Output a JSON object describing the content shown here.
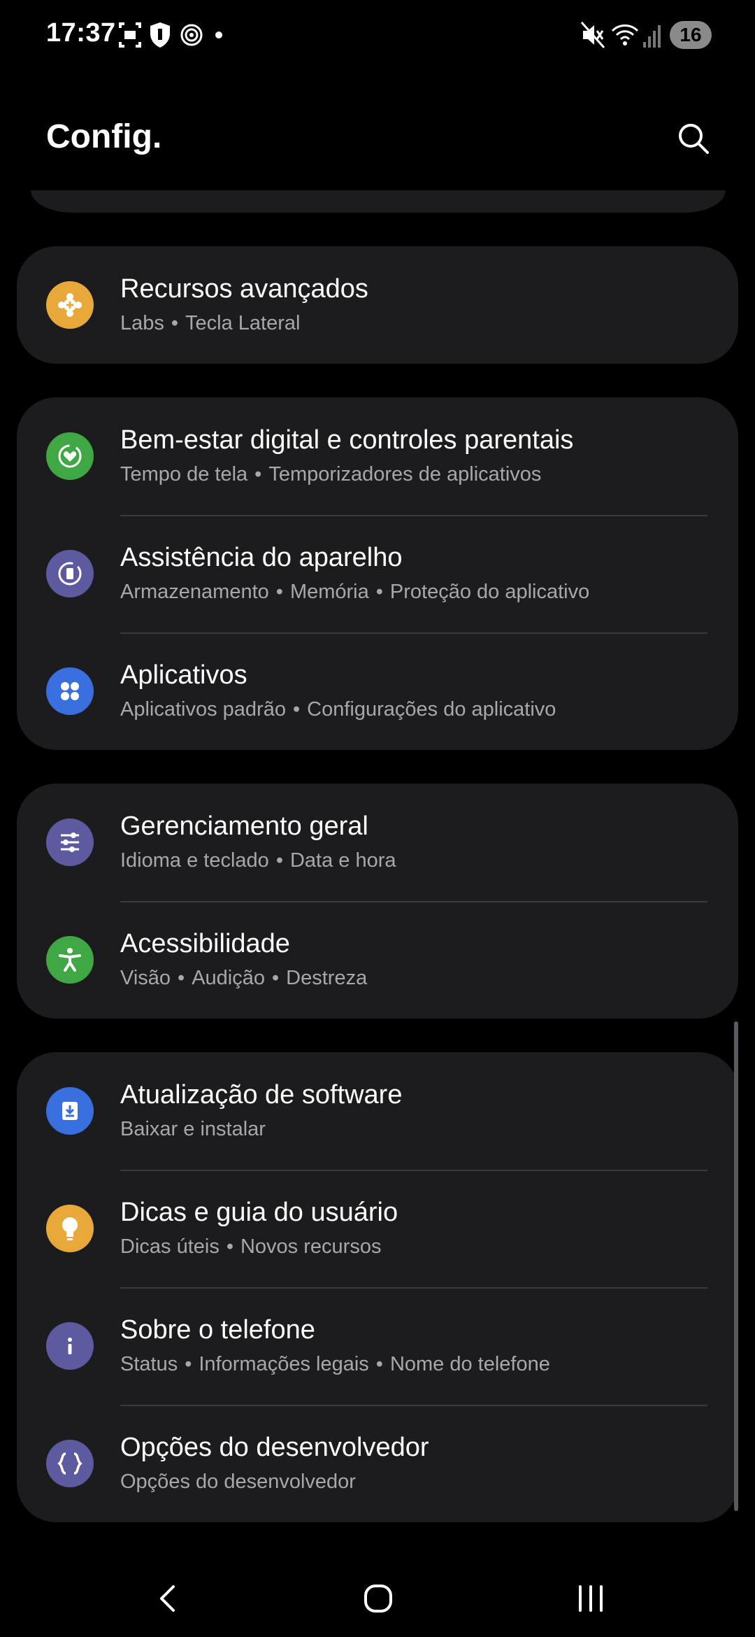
{
  "status_bar": {
    "time": "17:37",
    "battery": "16",
    "left_icons": [
      "screenshot-icon",
      "shield-icon",
      "hotspot-icon",
      "dot-icon"
    ],
    "right_icons": [
      "mute-icon",
      "wifi-icon",
      "signal-icon"
    ]
  },
  "header": {
    "title": "Config.",
    "search_icon": "search-icon"
  },
  "cards": [
    {
      "items": [
        {
          "title": "Recursos avançados",
          "subtitle_parts": [
            "Labs",
            "Tecla Lateral"
          ],
          "icon": "gear-plus-icon",
          "color": "#e8a93a"
        }
      ]
    },
    {
      "items": [
        {
          "title": "Bem-estar digital e controles parentais",
          "subtitle_parts": [
            "Tempo de tela",
            "Temporizadores de aplicativos"
          ],
          "icon": "heart-circle-icon",
          "color": "#3fa845"
        },
        {
          "title": "Assistência do aparelho",
          "subtitle_parts": [
            "Armazenamento",
            "Memória",
            "Proteção do aplicativo"
          ],
          "icon": "device-care-icon",
          "color": "#5e5aa0"
        },
        {
          "title": "Aplicativos",
          "subtitle_parts": [
            "Aplicativos padrão",
            "Configurações do aplicativo"
          ],
          "icon": "apps-grid-icon",
          "color": "#3a6fe0"
        }
      ]
    },
    {
      "items": [
        {
          "title": "Gerenciamento geral",
          "subtitle_parts": [
            "Idioma e teclado",
            "Data e hora"
          ],
          "icon": "sliders-icon",
          "color": "#5e5aa0"
        },
        {
          "title": "Acessibilidade",
          "subtitle_parts": [
            "Visão",
            "Audição",
            "Destreza"
          ],
          "icon": "accessibility-icon",
          "color": "#3fa845"
        }
      ]
    },
    {
      "items": [
        {
          "title": "Atualização de software",
          "subtitle_parts": [
            "Baixar e instalar"
          ],
          "icon": "download-icon",
          "color": "#3a6fe0"
        },
        {
          "title": "Dicas e guia do usuário",
          "subtitle_parts": [
            "Dicas úteis",
            "Novos recursos"
          ],
          "icon": "lightbulb-icon",
          "color": "#e8a93a"
        },
        {
          "title": "Sobre o telefone",
          "subtitle_parts": [
            "Status",
            "Informações legais",
            "Nome do telefone"
          ],
          "icon": "info-icon",
          "color": "#5e5aa0"
        },
        {
          "title": "Opções do desenvolvedor",
          "subtitle_parts": [
            "Opções do desenvolvedor"
          ],
          "icon": "braces-icon",
          "color": "#5e5aa0"
        }
      ]
    }
  ],
  "nav_bar": {
    "back_icon": "back-icon",
    "home_icon": "home-icon",
    "recents_icon": "recents-icon"
  }
}
